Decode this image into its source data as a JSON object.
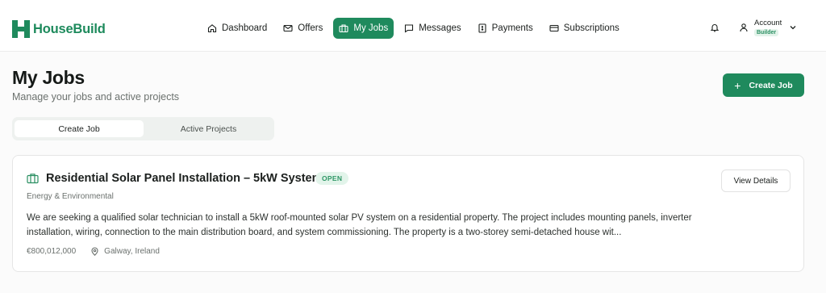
{
  "brand": {
    "name": "HouseBuild",
    "color": "#1f8a5d"
  },
  "nav": {
    "items": [
      {
        "label": "Dashboard",
        "icon": "home-icon",
        "active": false
      },
      {
        "label": "Offers",
        "icon": "mail-icon",
        "active": false
      },
      {
        "label": "My Jobs",
        "icon": "briefcase-icon",
        "active": true
      },
      {
        "label": "Messages",
        "icon": "chat-icon",
        "active": false
      },
      {
        "label": "Payments",
        "icon": "receipt-icon",
        "active": false
      },
      {
        "label": "Subscriptions",
        "icon": "card-icon",
        "active": false
      }
    ]
  },
  "account": {
    "label": "Account",
    "role": "Builder",
    "icon": "user-icon"
  },
  "notifications": {
    "icon": "bell-icon"
  },
  "page": {
    "title": "My Jobs",
    "subtitle": "Manage your jobs and active projects",
    "create_button": "Create Job"
  },
  "tabs": [
    {
      "label": "Create Job",
      "selected": true
    },
    {
      "label": "Active Projects",
      "selected": false
    }
  ],
  "jobs": [
    {
      "title": "Residential Solar Panel Installation – 5kW System",
      "status": "OPEN",
      "category": "Energy & Environmental",
      "description": "We are seeking a qualified solar technician to install a 5kW roof-mounted solar PV system on a residential property. The project includes mounting panels, inverter installation, wiring, connection to the main distribution board, and system commissioning. The property is a two-storey semi-detached house wit...",
      "budget": "€800,012,000",
      "location": "Galway, Ireland",
      "view_button": "View Details"
    }
  ]
}
